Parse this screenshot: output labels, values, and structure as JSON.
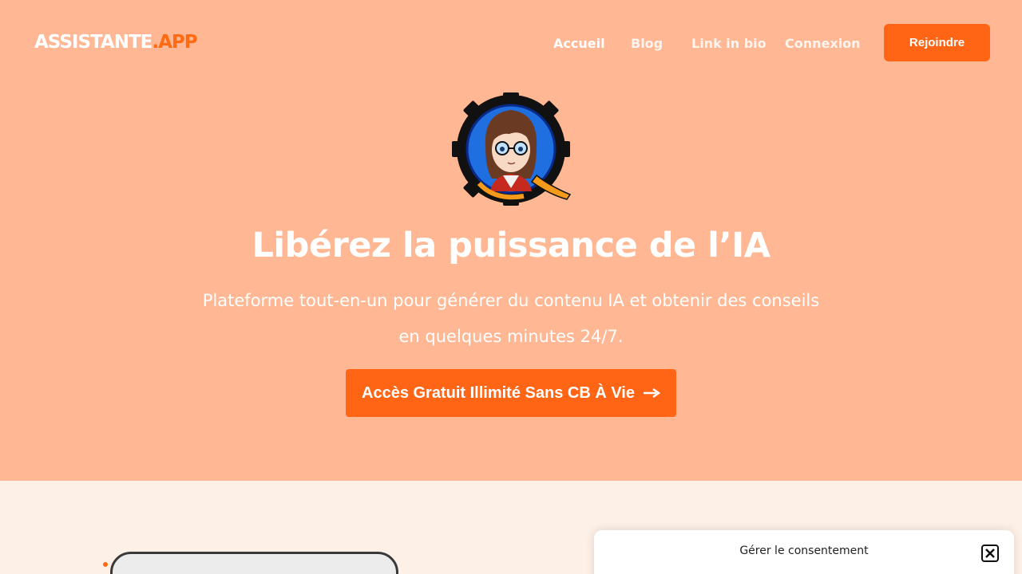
{
  "header": {
    "logo_main": "ASSISTANTE",
    "logo_accent": ".APP",
    "nav": [
      {
        "label": "Accueil"
      },
      {
        "label": "Blog"
      },
      {
        "label": "Link in bio"
      },
      {
        "label": "Connexion"
      }
    ],
    "join_label": "Rejoindre"
  },
  "hero": {
    "headline": "Libérez la puissance de l’IA",
    "sub_line1": "Plateforme tout-en-un pour générer du contenu IA et obtenir des conseils",
    "sub_line2": "en quelques minutes 24/7.",
    "cta_label": "Accès Gratuit Illimité Sans CB À Vie",
    "cta_icon": "arrow-right-icon"
  },
  "consent": {
    "title": "Gérer le consentement",
    "close_icon": "close-icon"
  },
  "colors": {
    "hero_bg": "#ffb794",
    "accent": "#ff6515",
    "page_bg": "#fdf0e6"
  }
}
